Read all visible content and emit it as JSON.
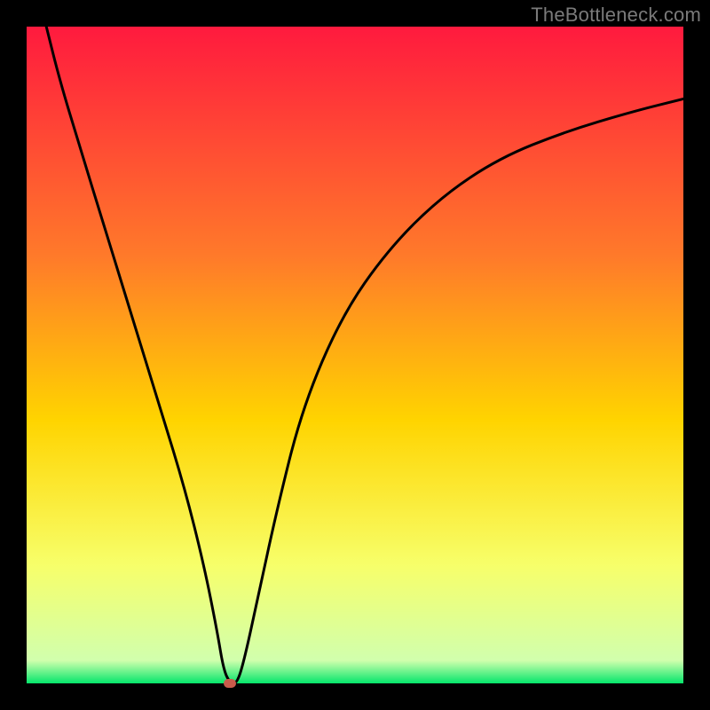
{
  "watermark": "TheBottleneck.com",
  "colors": {
    "bg_black": "#000000",
    "grad_top": "#ff1a3e",
    "grad_mid1": "#ff7a2a",
    "grad_mid2": "#ffd400",
    "grad_mid3": "#f7ff6a",
    "grad_bottom": "#05e66b",
    "curve": "#000000",
    "marker": "#c95b4b"
  },
  "chart_data": {
    "type": "line",
    "title": "",
    "xlabel": "",
    "ylabel": "",
    "xlim": [
      0,
      100
    ],
    "ylim": [
      0,
      100
    ],
    "series": [
      {
        "name": "bottleneck-curve",
        "x": [
          3,
          5,
          8,
          12,
          16,
          20,
          24,
          27,
          29,
          30,
          31,
          32,
          33,
          35,
          38,
          42,
          48,
          55,
          63,
          72,
          82,
          92,
          100
        ],
        "y": [
          100,
          92,
          82,
          69,
          56,
          43,
          30,
          18,
          8,
          2,
          0,
          0,
          3,
          12,
          26,
          42,
          56,
          66,
          74,
          80,
          84,
          87,
          89
        ]
      }
    ],
    "annotations": [
      {
        "name": "min-marker",
        "x": 31,
        "y": 0
      }
    ],
    "gradient_stops": [
      {
        "pos": 0.0,
        "color": "#ff1a3e"
      },
      {
        "pos": 0.35,
        "color": "#ff7a2a"
      },
      {
        "pos": 0.6,
        "color": "#ffd400"
      },
      {
        "pos": 0.82,
        "color": "#f7ff6a"
      },
      {
        "pos": 0.965,
        "color": "#d1ffad"
      },
      {
        "pos": 1.0,
        "color": "#05e66b"
      }
    ]
  }
}
